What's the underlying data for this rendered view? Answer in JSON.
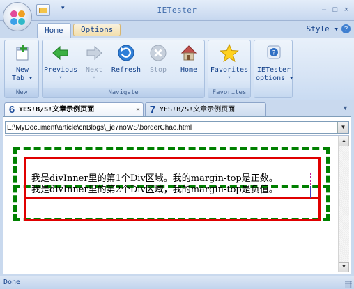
{
  "window": {
    "title": "IETester"
  },
  "quick_access": {
    "menu_glyph": "▾"
  },
  "window_buttons": [
    "–",
    "□",
    "×"
  ],
  "ribbon_tabs": [
    {
      "label": "Home",
      "active": true
    },
    {
      "label": "Options",
      "active": false
    }
  ],
  "style_menu": {
    "label": "Style ▾",
    "help": "?"
  },
  "groups": {
    "new": {
      "label": "New",
      "buttons": [
        {
          "label": "New",
          "sub": "Tab ▾",
          "icon": "new-tab-icon"
        }
      ]
    },
    "navigate": {
      "label": "Navigate",
      "buttons": [
        {
          "label": "Previous",
          "drop": "▾",
          "icon": "back-arrow-icon",
          "enabled": true
        },
        {
          "label": "Next",
          "drop": "▾",
          "icon": "forward-arrow-icon",
          "enabled": false
        },
        {
          "label": "Refresh",
          "icon": "refresh-icon",
          "enabled": true
        },
        {
          "label": "Stop",
          "icon": "stop-icon",
          "enabled": false
        },
        {
          "label": "Home",
          "icon": "home-icon",
          "enabled": true
        }
      ]
    },
    "favorites": {
      "label": "Favorites",
      "buttons": [
        {
          "label": "Favorites",
          "drop": "▾",
          "icon": "star-icon"
        }
      ]
    },
    "options": {
      "buttons": [
        {
          "label": "IETester",
          "sub": "options ▾",
          "icon": "options-icon"
        }
      ]
    }
  },
  "doc_tabs": [
    {
      "version": "6",
      "title": "YES!B/S!文章示例页面",
      "close": "×",
      "active": true
    },
    {
      "version": "7",
      "title": "YES!B/S!文章示例页面",
      "active": false
    }
  ],
  "doc_tabs_scroll": "▼",
  "address": {
    "value": "E:\\MyDocument\\article\\cnBlogs\\_je7noWS\\borderChao.html",
    "drop": "▼"
  },
  "page": {
    "div1_text": "我是divInner里的第1个Div区域。我的margin-top是正数。",
    "div2_text": "我是divInner里的第2个Div区域，我的margin-top是负值。"
  },
  "scrollbar": {
    "up": "▲",
    "down": "▼"
  },
  "status": {
    "text": "Done"
  },
  "colors": {
    "accent": "#15428b",
    "dashed_border": "#008000",
    "solid_border": "#e00000"
  }
}
